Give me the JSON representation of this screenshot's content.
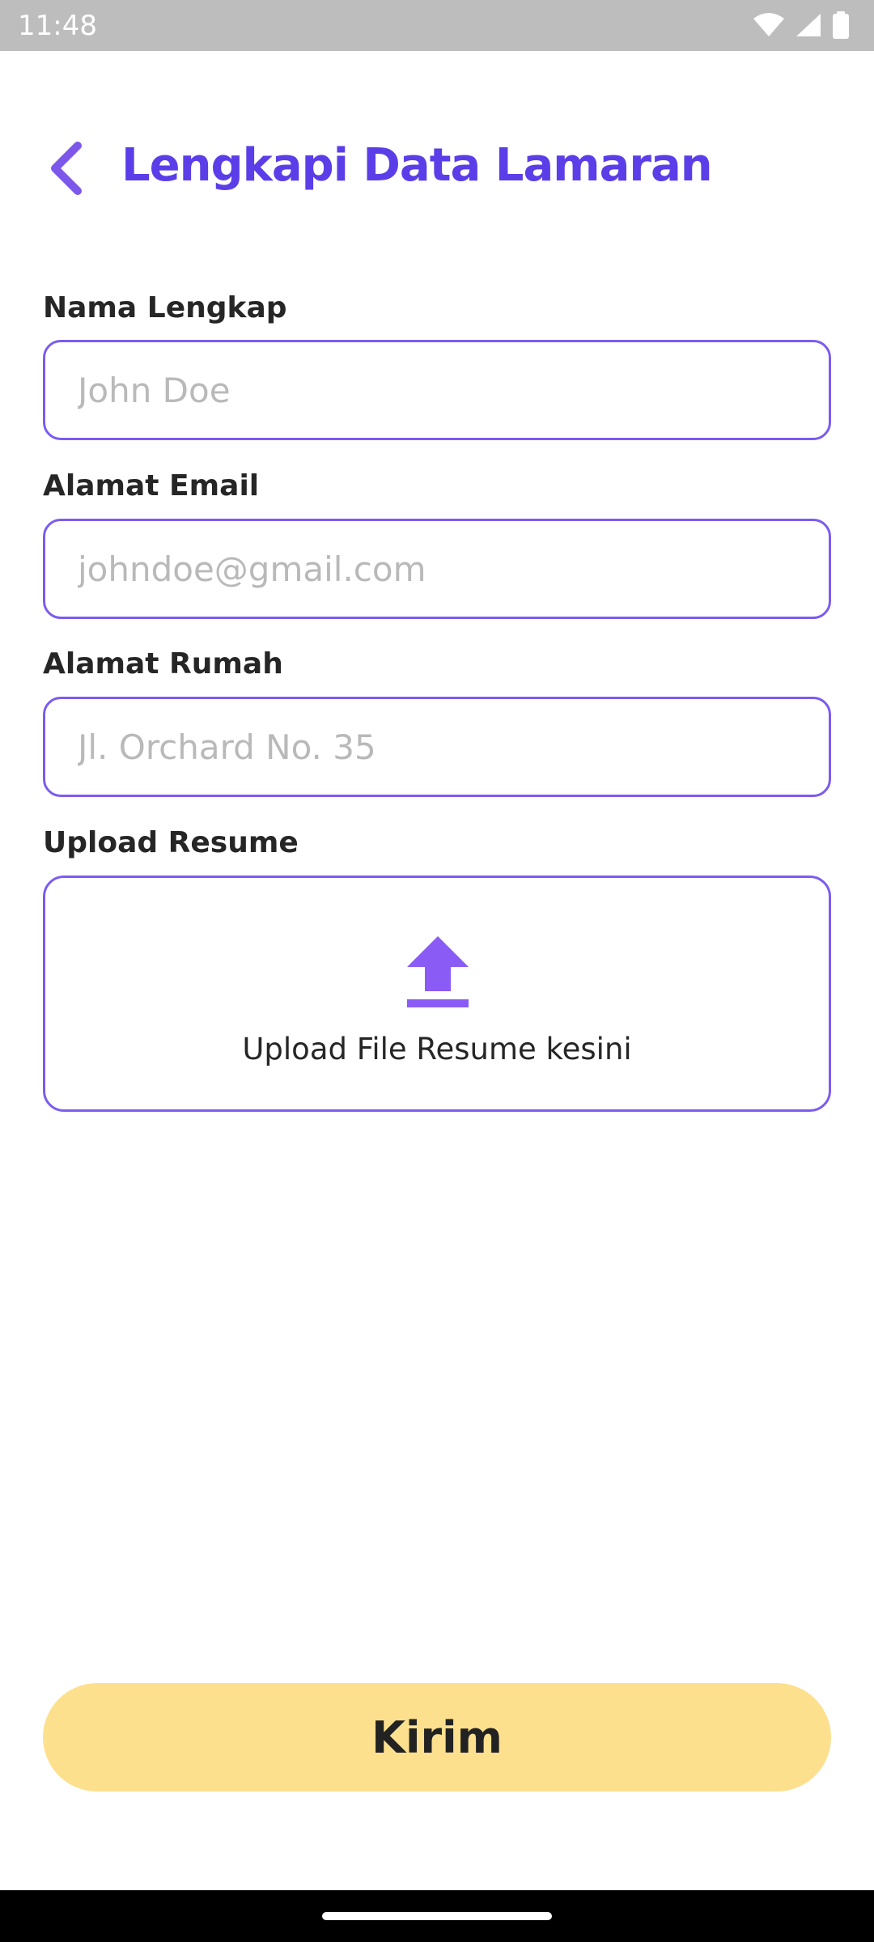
{
  "status_bar": {
    "time": "11:48",
    "icons": [
      "wifi-icon",
      "signal-icon",
      "battery-icon"
    ]
  },
  "header": {
    "title": "Lengkapi Data Lamaran",
    "back_icon": "chevron-left-icon"
  },
  "form": {
    "name": {
      "label": "Nama Lengkap",
      "placeholder": "John Doe",
      "value": ""
    },
    "email": {
      "label": "Alamat Email",
      "placeholder": "johndoe@gmail.com",
      "value": ""
    },
    "address": {
      "label": "Alamat Rumah",
      "placeholder": "Jl. Orchard No. 35",
      "value": ""
    },
    "resume": {
      "label": "Upload Resume",
      "upload_text": "Upload File Resume kesini",
      "icon": "upload-icon"
    }
  },
  "submit": {
    "label": "Kirim"
  },
  "colors": {
    "accent": "#5b3ee8",
    "border": "#7c5cf0",
    "button_bg": "#fde08e",
    "placeholder": "#b9b9b9"
  }
}
